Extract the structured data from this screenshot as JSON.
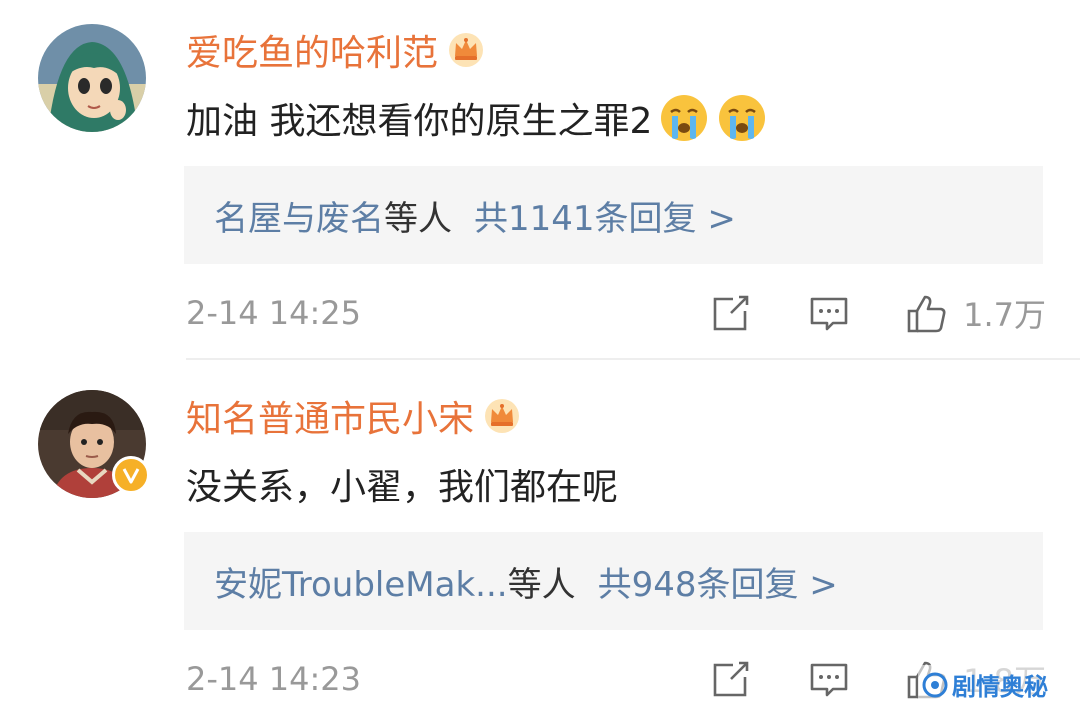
{
  "comments": [
    {
      "username": "爱吃鱼的哈利范",
      "text": "加油 我还想看你的原生之罪2",
      "emoji_count": 2,
      "reply_names": "名屋与废名",
      "reply_suffix": "等人",
      "reply_count": "共1141条回复 >",
      "time": "2-14 14:25",
      "likes": "1.7万",
      "verified": false
    },
    {
      "username": "知名普通市民小宋",
      "text": "没关系，小翟，我们都在呢",
      "emoji_count": 0,
      "reply_names": "安妮TroubleMak...",
      "reply_suffix": "等人",
      "reply_count": "共948条回复 >",
      "time": "2-14 14:23",
      "likes": "1.8万",
      "verified": true
    }
  ],
  "watermark": "剧情奥秘",
  "icons": [
    "crown-badge-icon",
    "crying-emoji-icon",
    "share-icon",
    "comment-icon",
    "thumbs-up-icon",
    "verified-v-icon"
  ],
  "colors": {
    "username": "#e8733a",
    "link": "#5d7ea5",
    "meta": "#999999",
    "reply_bg": "#f5f5f5",
    "verified": "#f6b027"
  }
}
